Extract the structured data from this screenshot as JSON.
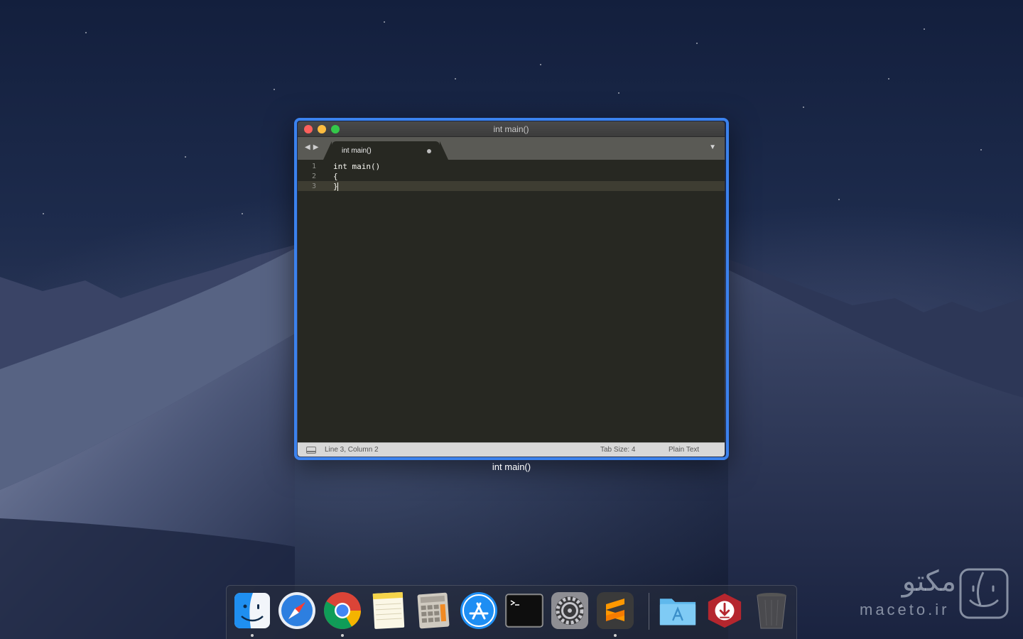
{
  "window": {
    "title": "int main()",
    "caption": "int main()",
    "tab": {
      "label": "int main()"
    },
    "editor": {
      "lines": [
        {
          "number": "1",
          "text": "int main()"
        },
        {
          "number": "2",
          "text": "{"
        },
        {
          "number": "3",
          "text": "}"
        }
      ]
    },
    "status": {
      "position": "Line 3, Column 2",
      "tab_size": "Tab Size: 4",
      "syntax": "Plain Text"
    }
  },
  "dock": {
    "apps": [
      {
        "name": "finder-icon",
        "running": true
      },
      {
        "name": "safari-icon",
        "running": false
      },
      {
        "name": "chrome-icon",
        "running": true
      },
      {
        "name": "notes-icon",
        "running": false
      },
      {
        "name": "calculator-icon",
        "running": false
      },
      {
        "name": "app-store-icon",
        "running": false
      },
      {
        "name": "terminal-icon",
        "running": false
      },
      {
        "name": "system-preferences-icon",
        "running": false
      },
      {
        "name": "sublime-text-icon",
        "running": true
      },
      {
        "name": "applications-folder-icon",
        "running": false
      },
      {
        "name": "downloads-icon",
        "running": false
      },
      {
        "name": "trash-icon",
        "running": false
      }
    ]
  },
  "watermark": {
    "persian": "مکتو",
    "latin": "maceto.ir"
  },
  "colors": {
    "highlight": "#3b82ee",
    "editor_bg": "#272822",
    "close": "#fc605c",
    "minimize": "#fdbc40",
    "maximize": "#34c84a"
  }
}
